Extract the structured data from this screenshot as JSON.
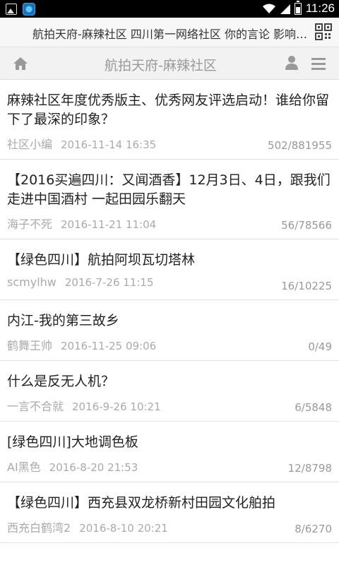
{
  "status_bar": {
    "time": "11:26",
    "battery_level": 0.6,
    "icons": [
      "image-icon",
      "app-icon",
      "wifi-icon",
      "signal-icon",
      "battery-icon"
    ]
  },
  "address_bar": {
    "text": "航拍天府-麻辣社区 四川第一网络社区 你的言论 影响四川",
    "qr_icon": "qr-code-icon"
  },
  "header": {
    "title": "航拍天府-麻辣社区",
    "home_icon": "home-icon",
    "user_icon": "user-icon",
    "menu_icon": "menu-icon"
  },
  "posts": [
    {
      "title": "麻辣社区年度优秀版主、优秀网友评选启动！谁给你留下了最深的印象？",
      "author": "社区小编",
      "date": "2016-11-14 16:35",
      "count": "502/881955"
    },
    {
      "title": "【2016买遍四川：又闻酒香】12月3日、4日，跟我们走进中国酒村 一起田园乐翻天",
      "author": "海子不死",
      "date": "2016-11-21 11:04",
      "count": "56/78566"
    },
    {
      "title": "【绿色四川】航拍阿坝瓦切塔林",
      "author": "scmylhw",
      "date": "2016-7-26 11:15",
      "count": "16/10225"
    },
    {
      "title": "内江-我的第三故乡",
      "author": "鹤舞王帅",
      "date": "2016-11-25 09:06",
      "count": "0/49"
    },
    {
      "title": "什么是反无人机？",
      "author": "一言不合就",
      "date": "2016-9-26 10:21",
      "count": "6/5848"
    },
    {
      "title": "[绿色四川]大地调色板",
      "author": "AI黑色",
      "date": "2016-8-20 21:53",
      "count": "12/8798"
    },
    {
      "title": "【绿色四川】西充县双龙桥新村田园文化舶拍",
      "author": "西充白鹤湾2",
      "date": "2016-8-10 20:21",
      "count": "8/6270"
    }
  ]
}
